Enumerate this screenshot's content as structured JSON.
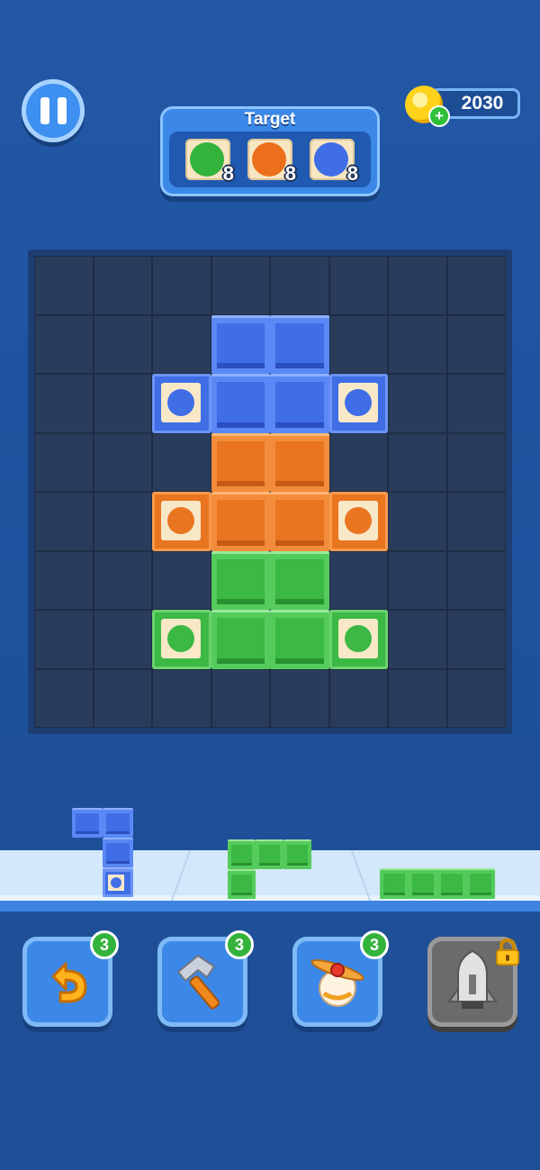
{
  "target": {
    "title": "Target",
    "items": [
      {
        "color": "#33b33c",
        "count": "8"
      },
      {
        "color": "#ec6f1c",
        "count": "8"
      },
      {
        "color": "#3f6ee6",
        "count": "8"
      }
    ]
  },
  "coins": {
    "value": "2030"
  },
  "board": {
    "size": 8,
    "blocks": [
      {
        "r": 1,
        "c": 3,
        "color": "blue"
      },
      {
        "r": 1,
        "c": 4,
        "color": "blue"
      },
      {
        "r": 2,
        "c": 2,
        "color": "blue",
        "tile": true
      },
      {
        "r": 2,
        "c": 3,
        "color": "blue"
      },
      {
        "r": 2,
        "c": 4,
        "color": "blue"
      },
      {
        "r": 2,
        "c": 5,
        "color": "blue",
        "tile": true
      },
      {
        "r": 3,
        "c": 3,
        "color": "orange"
      },
      {
        "r": 3,
        "c": 4,
        "color": "orange"
      },
      {
        "r": 4,
        "c": 2,
        "color": "orange",
        "tile": true
      },
      {
        "r": 4,
        "c": 3,
        "color": "orange"
      },
      {
        "r": 4,
        "c": 4,
        "color": "orange"
      },
      {
        "r": 4,
        "c": 5,
        "color": "orange",
        "tile": true
      },
      {
        "r": 5,
        "c": 3,
        "color": "green"
      },
      {
        "r": 5,
        "c": 4,
        "color": "green"
      },
      {
        "r": 6,
        "c": 2,
        "color": "green",
        "tile": true
      },
      {
        "r": 6,
        "c": 3,
        "color": "green"
      },
      {
        "r": 6,
        "c": 4,
        "color": "green"
      },
      {
        "r": 6,
        "c": 5,
        "color": "green",
        "tile": true
      }
    ]
  },
  "colors": {
    "blue": "#3f6ee6",
    "orange": "#ea7520",
    "green": "#3cb844"
  },
  "tray": [
    {
      "name": "piece-blue-j",
      "color": "blue",
      "cells": [
        [
          0,
          0
        ],
        [
          0,
          1
        ],
        [
          1,
          1
        ],
        [
          2,
          1,
          "tile"
        ]
      ]
    },
    {
      "name": "piece-green-l",
      "color": "green",
      "cells": [
        [
          0,
          0
        ],
        [
          0,
          1
        ],
        [
          0,
          2
        ],
        [
          1,
          0
        ]
      ]
    },
    {
      "name": "piece-green-line",
      "color": "green",
      "cells": [
        [
          0,
          0
        ],
        [
          0,
          1
        ],
        [
          0,
          2
        ],
        [
          0,
          3
        ]
      ]
    }
  ],
  "tools": [
    {
      "name": "undo",
      "icon": "undo-arrow-icon",
      "count": "3"
    },
    {
      "name": "hammer",
      "icon": "hammer-icon",
      "count": "3"
    },
    {
      "name": "propeller",
      "icon": "propeller-bomb-icon",
      "count": "3"
    },
    {
      "name": "rocket",
      "icon": "rocket-icon",
      "locked": true
    }
  ]
}
